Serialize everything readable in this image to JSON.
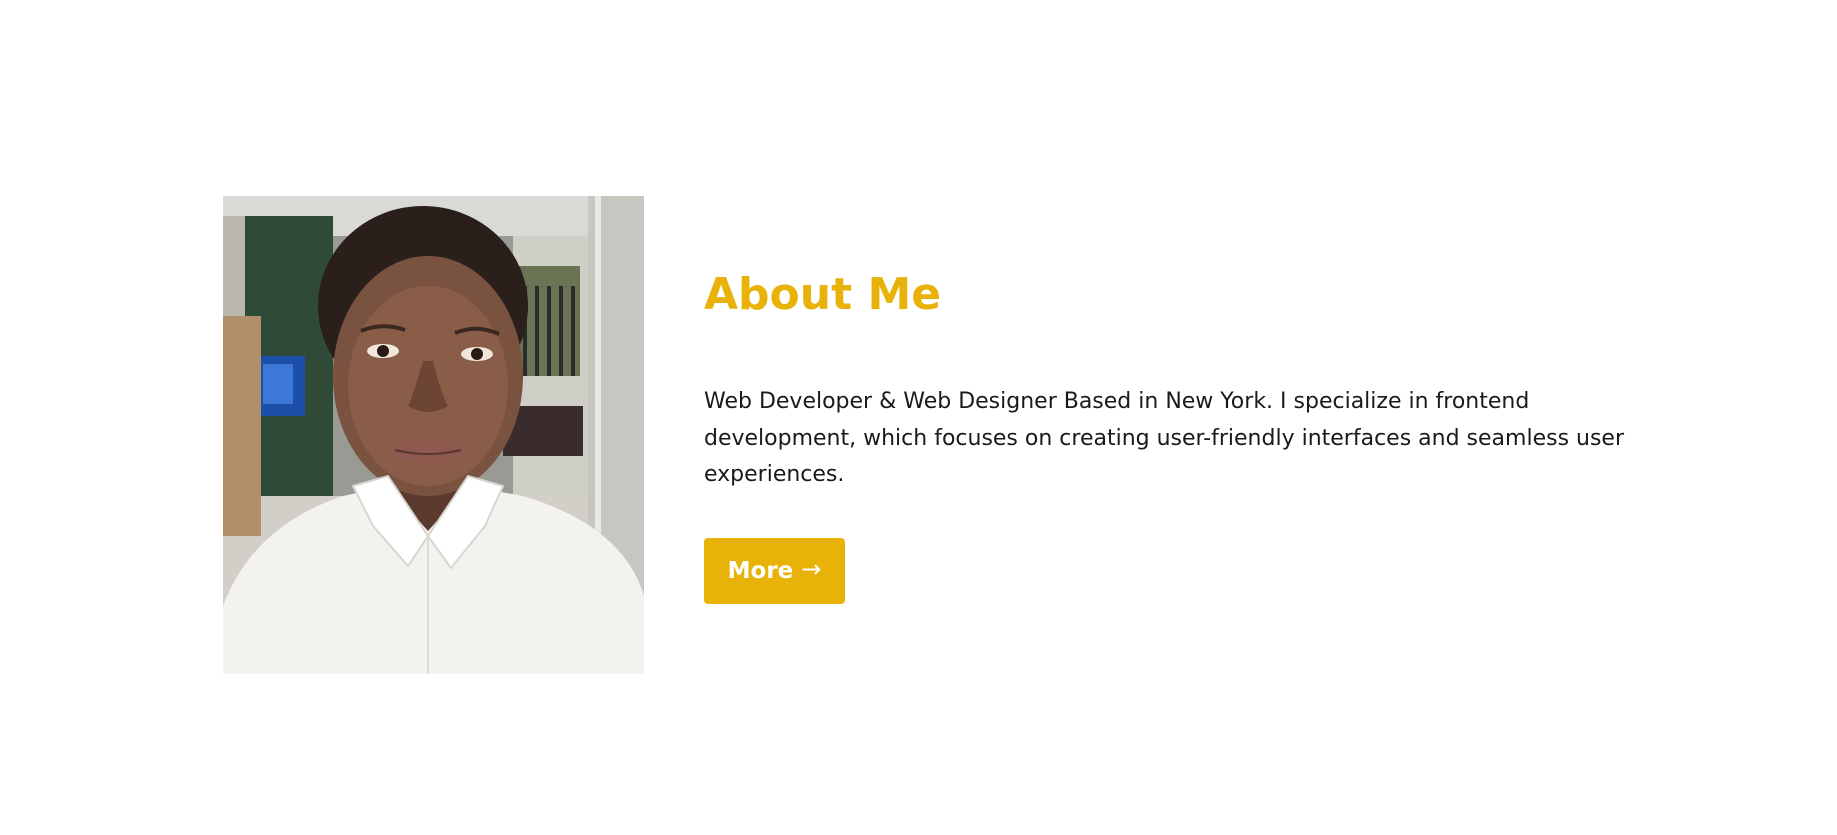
{
  "about": {
    "title": "About Me",
    "description": "Web Developer & Web Designer Based in New York. I specialize in frontend development, which focuses on creating user-friendly interfaces and seamless user experiences.",
    "button_label": "More",
    "button_icon": "→",
    "portrait_icon": "portrait-photo"
  },
  "colors": {
    "accent": "#e8b209",
    "text": "#1a1a1a",
    "background": "#ffffff",
    "button_text": "#ffffff"
  }
}
